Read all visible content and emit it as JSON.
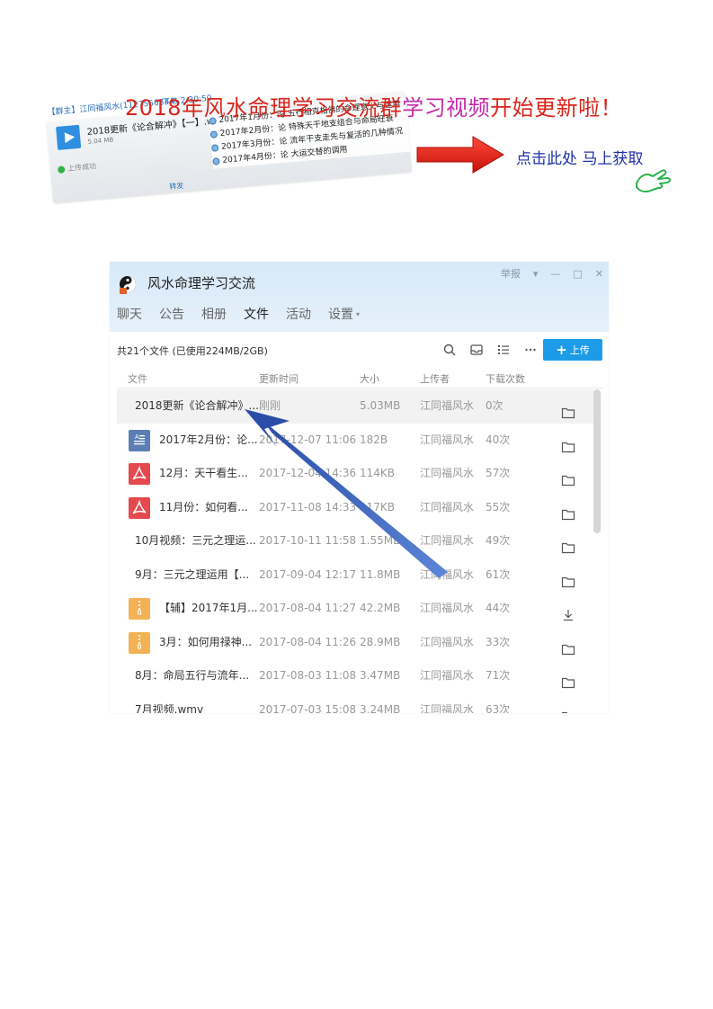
{
  "banner": {
    "title_part1": "2018年风水命理学习交流群",
    "title_part2": "学习视频",
    "title_part3": "开始更新啦！",
    "cta": "点击此处  马上获取",
    "chat": {
      "sender": "【群主】江同福风水(1127556344)",
      "time": "下午 2:30:50",
      "file_name": "2018更新《论合解冲》【一】.w",
      "file_size": "5.04 MB",
      "upload_status": "上传成功",
      "forward": "转发",
      "months": [
        "2017年1月份：论 五行相克相佛的命理意义与运用",
        "2017年2月份：论 特殊天干地支组合与命局旺衰",
        "2017年3月份：论 流年干支走先与复活的几种情况",
        "2017年4月份：论 大运交替的调用"
      ]
    },
    "colors": {
      "red": "#d9261c",
      "purple": "#c72aa8",
      "navy": "#1d2fa6"
    }
  },
  "app": {
    "title": "风水命理学习交流",
    "window_controls": {
      "report": "举报",
      "dropdown": "▾",
      "minimize": "—",
      "maximize": "□",
      "close": "✕"
    },
    "tabs": [
      {
        "label": "聊天"
      },
      {
        "label": "公告"
      },
      {
        "label": "相册"
      },
      {
        "label": "文件"
      },
      {
        "label": "活动"
      },
      {
        "label": "设置"
      }
    ],
    "settings_caret": "▾",
    "file_summary": "共21个文件 (已使用224MB/2GB)",
    "upload_button": {
      "plus": "+",
      "label": "上传"
    },
    "columns": {
      "name": "文件",
      "time": "更新时间",
      "size": "大小",
      "uploader": "上传者",
      "downloads": "下载次数"
    },
    "accent": "#1e9be8",
    "files": [
      {
        "name": "2018更新《论合解冲》...",
        "time": "刚刚",
        "size": "5.03MB",
        "uploader": "江同福风水",
        "downloads": "0次",
        "type": "none",
        "action": "folder-icon"
      },
      {
        "name": "2017年2月份：论...",
        "time": "2017-12-07 11:06",
        "size": "182B",
        "uploader": "江同福风水",
        "downloads": "40次",
        "type": "doc",
        "action": "folder-icon"
      },
      {
        "name": "12月：天干看生...",
        "time": "2017-12-04 14:36",
        "size": "114KB",
        "uploader": "江同福风水",
        "downloads": "57次",
        "type": "pdf",
        "action": "folder-icon"
      },
      {
        "name": "11月份：如何看...",
        "time": "2017-11-08 14:33",
        "size": "117KB",
        "uploader": "江同福风水",
        "downloads": "55次",
        "type": "pdf",
        "action": "folder-icon"
      },
      {
        "name": "10月视频：三元之理运...",
        "time": "2017-10-11 11:58",
        "size": "1.55MB",
        "uploader": "江同福风水",
        "downloads": "49次",
        "type": "none",
        "action": "folder-icon"
      },
      {
        "name": "9月：三元之理运用【...",
        "time": "2017-09-04 12:17",
        "size": "11.8MB",
        "uploader": "江同福风水",
        "downloads": "61次",
        "type": "none",
        "action": "folder-icon"
      },
      {
        "name": "【辅】2017年1月...",
        "time": "2017-08-04 11:27",
        "size": "42.2MB",
        "uploader": "江同福风水",
        "downloads": "44次",
        "type": "zip",
        "action": "download-icon"
      },
      {
        "name": "3月：如何用禄神...",
        "time": "2017-08-04 11:26",
        "size": "28.9MB",
        "uploader": "江同福风水",
        "downloads": "33次",
        "type": "zip",
        "action": "folder-icon"
      },
      {
        "name": "8月：命局五行与流年...",
        "time": "2017-08-03 11:08",
        "size": "3.47MB",
        "uploader": "江同福风水",
        "downloads": "71次",
        "type": "none",
        "action": "folder-icon"
      },
      {
        "name": "7月视频.wmv",
        "time": "2017-07-03 15:08",
        "size": "3.24MB",
        "uploader": "江同福风水",
        "downloads": "63次",
        "type": "none",
        "action": "folder-icon"
      }
    ]
  }
}
